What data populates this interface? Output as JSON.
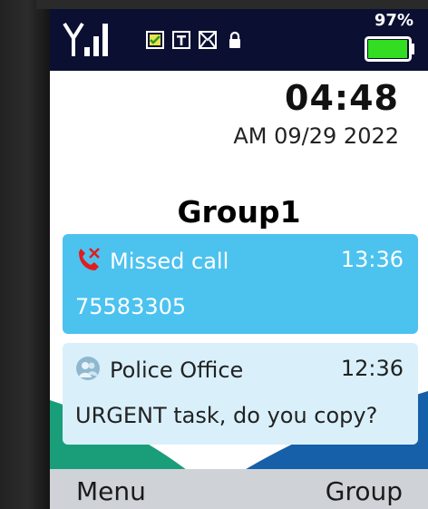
{
  "status_bar": {
    "battery_percent": "97%",
    "battery_level": 0.97,
    "battery_color": "#33dd22",
    "icons": [
      "signal-icon",
      "sim-check-icon",
      "text-mode-icon",
      "message-icon",
      "lock-icon"
    ]
  },
  "clock": {
    "time": "04:48",
    "date": "AM 09/29 2022"
  },
  "group": {
    "title": "Group1"
  },
  "notifications": [
    {
      "icon": "missed-call-icon",
      "title": "Missed call",
      "time": "13:36",
      "body": "75583305",
      "color": "#4cc2ef"
    },
    {
      "icon": "contact-avatar-icon",
      "title": "Police Office",
      "time": "12:36",
      "body": "URGENT task, do you copy?",
      "color": "#d9f0fb"
    }
  ],
  "scroll_hint": "chevron-down-icon",
  "softkeys": {
    "left": "Menu",
    "right": "Group"
  }
}
